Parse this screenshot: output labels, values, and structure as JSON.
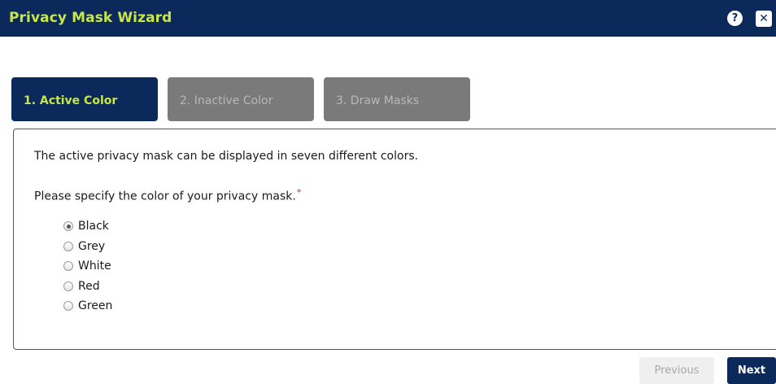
{
  "window": {
    "title": "Privacy Mask Wizard",
    "help_icon": "?",
    "close_icon": "✕"
  },
  "tabs": [
    {
      "label": "1. Active Color",
      "state": "active"
    },
    {
      "label": "2. Inactive Color",
      "state": "inactive"
    },
    {
      "label": "3. Draw Masks",
      "state": "inactive"
    }
  ],
  "content": {
    "intro": "The active privacy mask can be displayed in seven different colors.",
    "question": "Please specify the color of your privacy mask.",
    "required_marker": "*",
    "options": [
      {
        "label": "Black",
        "selected": true
      },
      {
        "label": "Grey",
        "selected": false
      },
      {
        "label": "White",
        "selected": false
      },
      {
        "label": "Red",
        "selected": false
      },
      {
        "label": "Green",
        "selected": false
      }
    ]
  },
  "footer": {
    "previous_label": "Previous",
    "previous_enabled": false,
    "next_label": "Next"
  },
  "colors": {
    "titlebar_bg": "#0b2a5b",
    "title_text": "#c8e64a",
    "inactive_tab_bg": "#7a7a7a",
    "required": "#d9252b"
  }
}
